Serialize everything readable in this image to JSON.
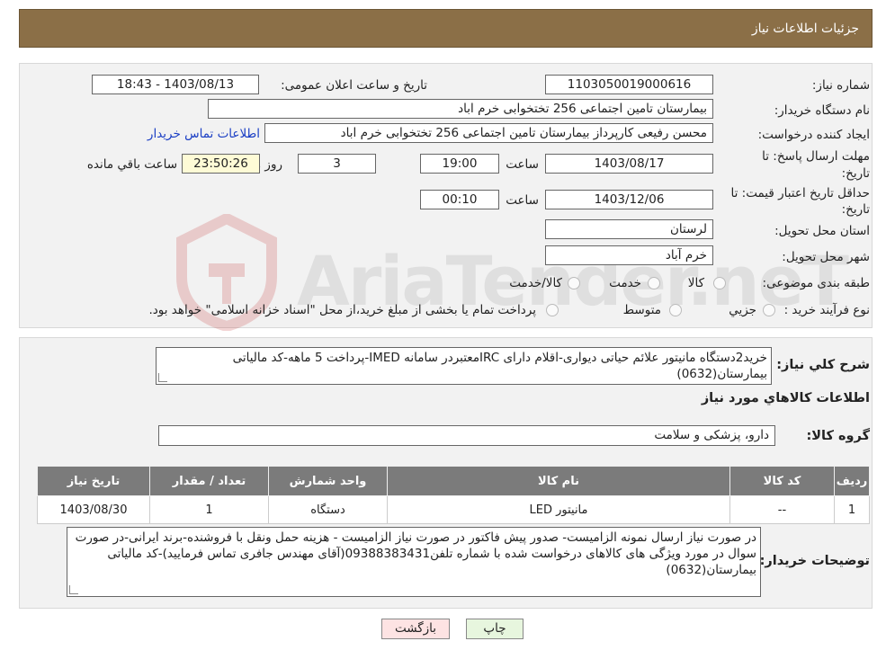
{
  "header": {
    "title": "جزئیات اطلاعات نیاز"
  },
  "form": {
    "need_number_label": "شماره نیاز:",
    "need_number": "1103050019000616",
    "announce_label": "تاریخ و ساعت اعلان عمومی:",
    "announce_value": "1403/08/13 - 18:43",
    "buyer_org_label": "نام دستگاه خریدار:",
    "buyer_org": "بیمارستان تامین اجتماعی  256 تختخوابی خرم اباد",
    "creator_label": "ایجاد کننده درخواست:",
    "creator": "محسن رفیعی کارپرداز بیمارستان تامین اجتماعی  256 تختخوابی خرم اباد",
    "contact_link": "اطلاعات تماس خریدار",
    "deadline_label_1": "مهلت ارسال پاسخ: تا",
    "deadline_label_2": "تاریخ:",
    "deadline_date": "1403/08/17",
    "time_label": "ساعت",
    "deadline_time": "19:00",
    "days_value": "3",
    "days_label": "روز و",
    "remaining_value": "23:50:26",
    "remaining_label": "ساعت باقي مانده",
    "validity_label_1": "حداقل تاریخ اعتبار قیمت: تا",
    "validity_label_2": "تاریخ:",
    "validity_date": "1403/12/06",
    "validity_time": "00:10",
    "province_label": "استان محل تحویل:",
    "province": "لرستان",
    "city_label": "شهر محل تحویل:",
    "city": "خرم آباد",
    "category_label": "طبقه بندی موضوعی:",
    "category_options": [
      "کالا",
      "خدمت",
      "کالا/خدمت"
    ],
    "process_label": "نوع فرآیند خرید :",
    "process_options": [
      "جزیي",
      "متوسط"
    ],
    "process_note": "پرداخت تمام یا بخشی از مبلغ خرید،از محل \"اسناد خزانه اسلامی\" خواهد بود."
  },
  "details": {
    "summary_label": "شرح کلي نياز:",
    "summary": "خرید2دستگاه مانیتور علائم حیاتی دیواری-اقلام دارای IRCمعتبردر سامانه IMED-پرداخت 5 ماهه-کد مالیاتی بیمارستان(0632)",
    "goods_info_title": "اطلاعات کالاهاي مورد نياز",
    "group_label": "گروه کالا:",
    "group_value": "دارو، پزشکی و سلامت",
    "table": {
      "headers": [
        "رديف",
        "کد کالا",
        "نام کالا",
        "واحد شمارش",
        "تعداد / مقدار",
        "تاریخ نیاز"
      ],
      "rows": [
        [
          "1",
          "--",
          "مانیتور LED",
          "دستگاه",
          "1",
          "1403/08/30"
        ]
      ]
    },
    "buyer_notes_label": "توضیحات خریدار:",
    "buyer_notes": "در صورت نیاز ارسال نمونه الزامیست- صدور پیش فاکتور در صورت نیاز الزامیست - هزینه حمل ونقل با فروشنده-برند ایرانی-در صورت سوال در مورد ویژگی های کالاهای درخواست شده با شماره تلفن09388383431(آقای مهندس جافری تماس فرمایید)-کد مالیاتی بیمارستان(0632)"
  },
  "buttons": {
    "print": "چاپ",
    "back": "بازگشت"
  },
  "watermark": {
    "text": "AriaTender.neT"
  },
  "colors": {
    "header_bg": "#8b6f47",
    "table_header_bg": "#7b7b7b",
    "back_button_bg": "#fde3e3",
    "print_button_bg": "#e7f6de"
  }
}
